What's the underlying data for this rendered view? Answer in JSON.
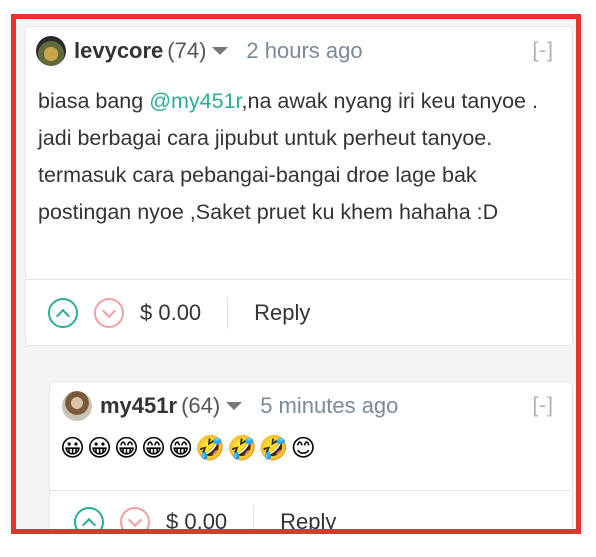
{
  "comments": [
    {
      "author": "levycore",
      "reputation": "(74)",
      "time": "2 hours ago",
      "collapse": "[-]",
      "body_pre": "biasa bang ",
      "mention": "@my451r",
      "body_post": ",na awak nyang iri keu tanyoe . jadi berbagai cara jipubut untuk perheut tanyoe. termasuk cara pebangai-bangai droe lage bak postingan nyoe ,Saket pruet ku khem hahaha :D",
      "payout": "$ 0.00",
      "reply_label": "Reply"
    },
    {
      "author": "my451r",
      "reputation": "(64)",
      "time": "5 minutes ago",
      "collapse": "[-]",
      "emojis": "😀😀😁😁😁🤣🤣🤣😊",
      "payout": "$ 0.00",
      "reply_label": "Reply"
    }
  ],
  "colors": {
    "accent": "#2bae94",
    "downvote": "#f0a0a0",
    "frame": "#e3342f"
  }
}
